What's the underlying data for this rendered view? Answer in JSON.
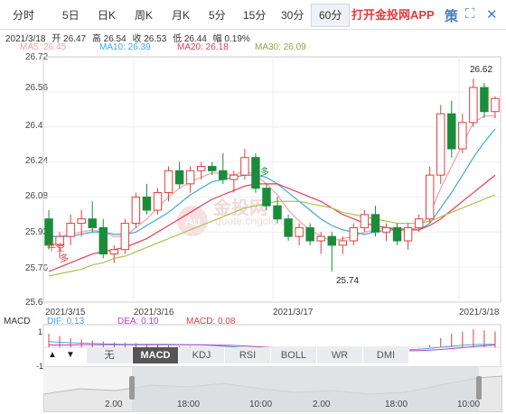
{
  "tabs": [
    {
      "label": "分时"
    },
    {
      "label": "5日"
    },
    {
      "label": "日K"
    },
    {
      "label": "周K"
    },
    {
      "label": "月K"
    },
    {
      "label": "5分"
    },
    {
      "label": "15分"
    },
    {
      "label": "30分"
    },
    {
      "label": "60分"
    }
  ],
  "promo": "打开金投网APP",
  "toolbar_icons": [
    "policy-icon",
    "fullscreen-icon",
    "close-icon"
  ],
  "info": {
    "date": "2021/3/18",
    "open": "开 26.47",
    "high": "高 26.54",
    "close": "收 26.53",
    "low": "低 26.44",
    "change": "幅 0.19%"
  },
  "ma": {
    "ma5": "MA5: 26.45",
    "ma10": "MA10: 26.39",
    "ma20": "MA20: 26.18",
    "ma30": "MA30: 26.09"
  },
  "colors": {
    "ma5": "#f3a1a8",
    "ma10": "#3da8e0",
    "ma20": "#e23e5a",
    "ma30": "#a8c54a",
    "up": "#e23e3e",
    "down": "#1a8c3a",
    "bg_grid": "#eeeeee"
  },
  "y_axis": [
    "26.72",
    "26.56",
    "26.4",
    "26.24",
    "26.08",
    "25.92",
    "25.76",
    "25.6"
  ],
  "x_axis": [
    "2021/3/15",
    "2021/3/16",
    "2021/3/17",
    "2021/3/18"
  ],
  "annotations": {
    "high": "26.62",
    "low": "25.74",
    "flat1": "平多",
    "flat2": "平多",
    "label3": "平空",
    "label4": "多"
  },
  "macd": {
    "title": "MACD",
    "dif": "DIF: 0.13",
    "dea": "DEA: 0.10",
    "macd": "MACD: 0.08",
    "y_top": "1",
    "y_mid": "0",
    "y_bot": "-1"
  },
  "indicator_tabs": [
    {
      "label": "无"
    },
    {
      "label": "MACD"
    },
    {
      "label": "KDJ"
    },
    {
      "label": "RSI"
    },
    {
      "label": "BOLL"
    },
    {
      "label": "WR"
    },
    {
      "label": "DMI"
    }
  ],
  "navigator": {
    "labels": [
      "2.00",
      "18:00",
      "10:00",
      "2.00",
      "18:00",
      "10:00"
    ]
  },
  "watermark": {
    "text": "金投网",
    "sub": "quote.cngold.org",
    "badge": "Au"
  },
  "chart_data": {
    "type": "candlestick",
    "title": "",
    "ylim": [
      25.6,
      26.72
    ],
    "candles": [
      [
        25.98,
        26.02,
        25.84,
        25.86
      ],
      [
        25.86,
        25.92,
        25.8,
        25.9
      ],
      [
        25.9,
        26.0,
        25.86,
        25.96
      ],
      [
        25.96,
        26.02,
        25.9,
        25.98
      ],
      [
        25.98,
        26.06,
        25.92,
        25.94
      ],
      [
        25.94,
        25.98,
        25.8,
        25.82
      ],
      [
        25.82,
        25.86,
        25.78,
        25.84
      ],
      [
        25.84,
        25.98,
        25.82,
        25.96
      ],
      [
        25.96,
        26.1,
        25.94,
        26.08
      ],
      [
        26.08,
        26.14,
        26.0,
        26.02
      ],
      [
        26.02,
        26.12,
        26.0,
        26.1
      ],
      [
        26.1,
        26.22,
        26.06,
        26.2
      ],
      [
        26.2,
        26.24,
        26.12,
        26.14
      ],
      [
        26.14,
        26.22,
        26.1,
        26.2
      ],
      [
        26.2,
        26.24,
        26.16,
        26.22
      ],
      [
        26.22,
        26.24,
        26.18,
        26.2
      ],
      [
        26.2,
        26.28,
        26.14,
        26.16
      ],
      [
        26.16,
        26.2,
        26.1,
        26.18
      ],
      [
        26.18,
        26.3,
        26.16,
        26.26
      ],
      [
        26.26,
        26.28,
        26.1,
        26.12
      ],
      [
        26.12,
        26.14,
        26.02,
        26.04
      ],
      [
        26.04,
        26.08,
        25.96,
        25.98
      ],
      [
        25.98,
        26.0,
        25.88,
        25.9
      ],
      [
        25.9,
        25.96,
        25.86,
        25.94
      ],
      [
        25.94,
        25.96,
        25.86,
        25.88
      ],
      [
        25.88,
        25.92,
        25.82,
        25.9
      ],
      [
        25.9,
        25.92,
        25.74,
        25.86
      ],
      [
        25.86,
        25.9,
        25.82,
        25.88
      ],
      [
        25.88,
        25.96,
        25.86,
        25.94
      ],
      [
        25.94,
        26.02,
        25.92,
        26.0
      ],
      [
        26.0,
        26.04,
        25.9,
        25.92
      ],
      [
        25.92,
        25.96,
        25.88,
        25.94
      ],
      [
        25.94,
        25.96,
        25.86,
        25.88
      ],
      [
        25.88,
        25.96,
        25.84,
        25.94
      ],
      [
        25.94,
        26.0,
        25.92,
        25.98
      ],
      [
        25.98,
        26.22,
        25.96,
        26.18
      ],
      [
        26.18,
        26.5,
        26.14,
        26.46
      ],
      [
        26.46,
        26.52,
        26.26,
        26.3
      ],
      [
        26.3,
        26.46,
        26.28,
        26.42
      ],
      [
        26.42,
        26.62,
        26.4,
        26.58
      ],
      [
        26.58,
        26.6,
        26.44,
        26.47
      ],
      [
        26.47,
        26.54,
        26.44,
        26.53
      ]
    ],
    "series": [
      {
        "name": "MA5",
        "values": [
          25.9,
          25.9,
          25.91,
          25.92,
          25.93,
          25.92,
          25.9,
          25.9,
          25.94,
          25.98,
          26.03,
          26.08,
          26.12,
          26.15,
          26.17,
          26.19,
          26.19,
          26.18,
          26.2,
          26.18,
          26.14,
          26.09,
          26.02,
          25.97,
          25.93,
          25.9,
          25.88,
          25.89,
          25.9,
          25.92,
          25.93,
          25.94,
          25.94,
          25.93,
          25.94,
          26.0,
          26.12,
          26.22,
          26.32,
          26.42,
          26.45,
          26.45
        ]
      },
      {
        "name": "MA10",
        "values": [
          25.9,
          25.9,
          25.9,
          25.91,
          25.92,
          25.92,
          25.91,
          25.91,
          25.92,
          25.95,
          25.98,
          26.01,
          26.05,
          26.09,
          26.12,
          26.15,
          26.16,
          26.17,
          26.18,
          26.18,
          26.17,
          26.14,
          26.1,
          26.06,
          26.02,
          25.98,
          25.95,
          25.93,
          25.92,
          25.91,
          25.92,
          25.93,
          25.93,
          25.93,
          25.93,
          25.96,
          26.03,
          26.1,
          26.18,
          26.26,
          26.33,
          26.39
        ]
      },
      {
        "name": "MA20",
        "values": [
          25.74,
          25.76,
          25.78,
          25.8,
          25.82,
          25.83,
          25.84,
          25.85,
          25.87,
          25.89,
          25.92,
          25.95,
          25.98,
          26.01,
          26.04,
          26.07,
          26.09,
          26.11,
          26.13,
          26.14,
          26.14,
          26.14,
          26.12,
          26.1,
          26.08,
          26.06,
          26.03,
          26.0,
          25.98,
          25.96,
          25.95,
          25.94,
          25.93,
          25.93,
          25.93,
          25.95,
          25.98,
          26.02,
          26.06,
          26.1,
          26.14,
          26.18
        ]
      },
      {
        "name": "MA30",
        "values": [
          25.72,
          25.73,
          25.74,
          25.75,
          25.77,
          25.78,
          25.8,
          25.81,
          25.83,
          25.85,
          25.87,
          25.89,
          25.91,
          25.93,
          25.95,
          25.97,
          25.99,
          26.01,
          26.03,
          26.04,
          26.05,
          26.06,
          26.06,
          26.06,
          26.05,
          26.04,
          26.03,
          26.01,
          26.0,
          25.99,
          25.98,
          25.97,
          25.96,
          25.96,
          25.96,
          25.97,
          25.99,
          26.01,
          26.03,
          26.05,
          26.07,
          26.09
        ]
      }
    ],
    "macd_bars": [
      0.6,
      0.5,
      0.4,
      0.35,
      0.3,
      0.25,
      0.22,
      0.2,
      0.18,
      0.15,
      0.12,
      0.08,
      0.05,
      0.03,
      0.02,
      0.0,
      -0.03,
      -0.06,
      -0.1,
      -0.14,
      -0.18,
      -0.22,
      -0.25,
      -0.26,
      -0.24,
      -0.2,
      -0.18,
      -0.15,
      -0.12,
      -0.1,
      -0.08,
      -0.06,
      -0.04,
      -0.03,
      -0.02,
      0.1,
      0.4,
      0.6,
      0.7,
      0.8,
      0.75,
      0.7
    ],
    "dif": [
      0.25,
      0.22,
      0.2,
      0.18,
      0.17,
      0.15,
      0.14,
      0.13,
      0.13,
      0.13,
      0.13,
      0.13,
      0.12,
      0.11,
      0.1,
      0.08,
      0.05,
      0.02,
      -0.02,
      -0.06,
      -0.1,
      -0.14,
      -0.18,
      -0.21,
      -0.23,
      -0.24,
      -0.24,
      -0.23,
      -0.21,
      -0.19,
      -0.17,
      -0.15,
      -0.13,
      -0.11,
      -0.09,
      -0.05,
      0.0,
      0.05,
      0.09,
      0.12,
      0.13,
      0.13
    ],
    "dea": [
      0.1,
      0.1,
      0.1,
      0.11,
      0.11,
      0.11,
      0.11,
      0.11,
      0.11,
      0.11,
      0.11,
      0.11,
      0.11,
      0.11,
      0.11,
      0.1,
      0.09,
      0.08,
      0.06,
      0.03,
      0.0,
      -0.03,
      -0.07,
      -0.1,
      -0.13,
      -0.15,
      -0.17,
      -0.18,
      -0.19,
      -0.19,
      -0.19,
      -0.18,
      -0.17,
      -0.16,
      -0.15,
      -0.13,
      -0.1,
      -0.06,
      -0.02,
      0.03,
      0.07,
      0.1
    ]
  }
}
